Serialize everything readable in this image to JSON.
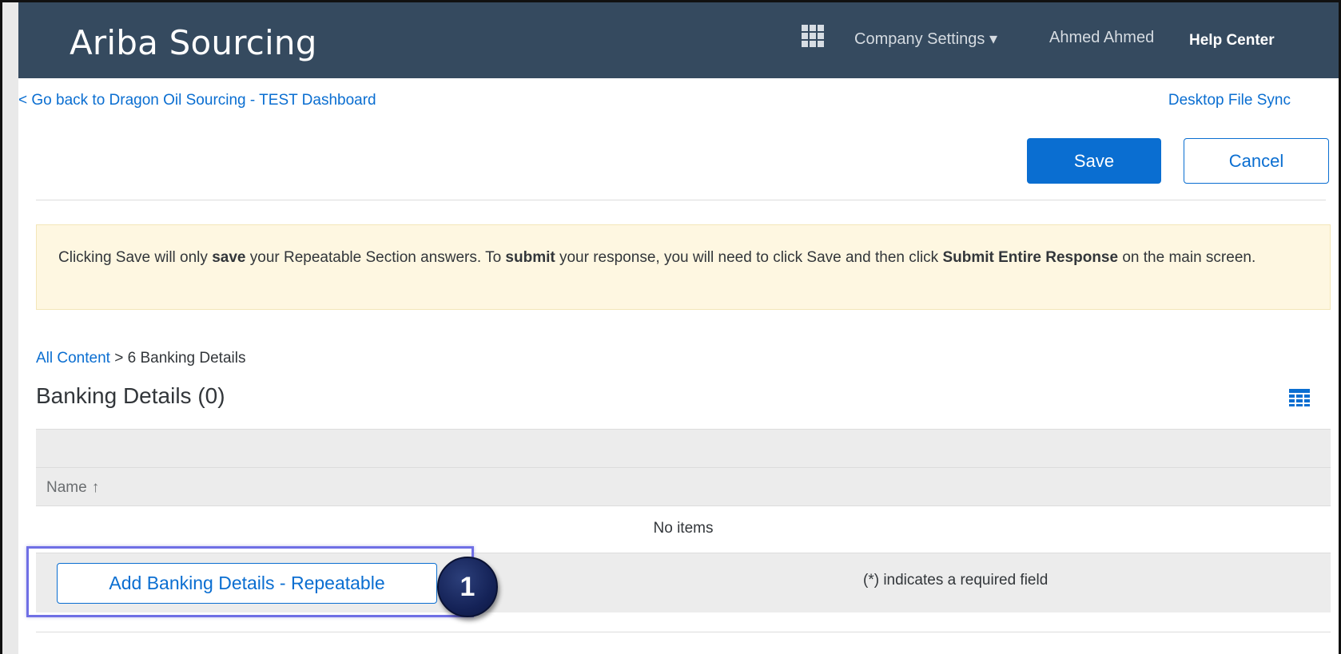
{
  "header": {
    "brand": "Ariba Sourcing",
    "company_settings": "Company Settings ▾",
    "user_name": "Ahmed Ahmed",
    "help_center": "Help Center"
  },
  "subnav": {
    "back_link": "< Go back to Dragon Oil Sourcing - TEST Dashboard",
    "desktop_sync": "Desktop File Sync"
  },
  "actions": {
    "save_label": "Save",
    "cancel_label": "Cancel"
  },
  "notice": {
    "part1": "Clicking Save will only ",
    "bold1": "save",
    "part2": " your Repeatable Section answers. To ",
    "bold2": "submit",
    "part3": " your response, you will need to click Save and then click ",
    "bold3": "Submit Entire Response",
    "part4": " on the main screen."
  },
  "breadcrumb": {
    "link": "All Content",
    "separator": " > ",
    "current": "6 Banking Details"
  },
  "section": {
    "title": "Banking Details (0)"
  },
  "table": {
    "columns": [
      {
        "label": "Name",
        "sort_icon": "↑"
      }
    ],
    "empty_text": "No items"
  },
  "footer": {
    "add_button_label": "Add Banking Details - Repeatable",
    "required_note": "(*) indicates a required field"
  },
  "annotation": {
    "step_number": "1"
  },
  "colors": {
    "header_bg": "#354a5f",
    "accent": "#0a6ed1",
    "notice_bg": "#fef7e1",
    "highlight": "#6f6fe5",
    "badge": "#152358"
  }
}
